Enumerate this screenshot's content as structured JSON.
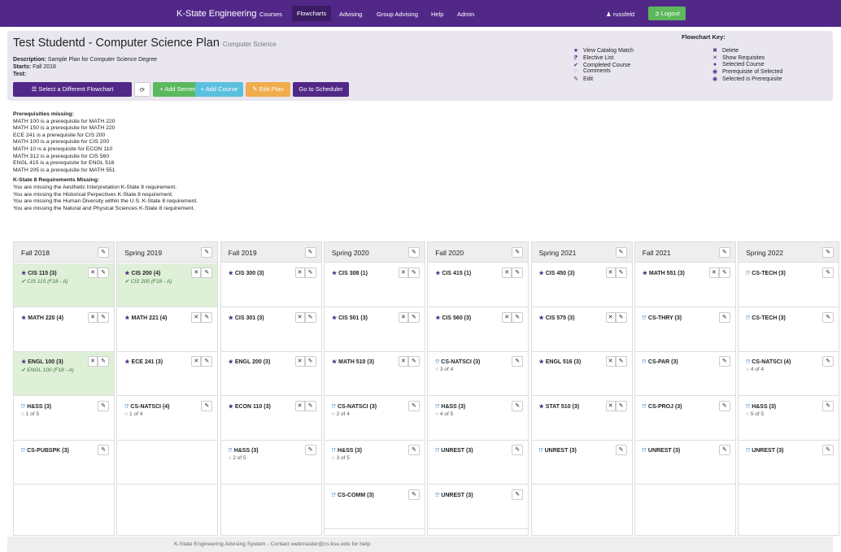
{
  "nav": {
    "brand": "K-State Engineering",
    "links": [
      "Courses",
      "Flowcharts",
      "Advising",
      "Group Advising",
      "Help",
      "Admin"
    ],
    "user": "russfeld",
    "logout": "Logout",
    "user_icon": "user-icon",
    "logout_icon": "sign-out-icon"
  },
  "plan": {
    "title": "Test Studentd - Computer Science Plan",
    "program": "Computer Science",
    "description_label": "Description:",
    "description": "Sample Plan for Computer Science Degree",
    "starts_label": "Starts:",
    "starts": "Fall 2018",
    "test_label": "Test:"
  },
  "buttons": {
    "select": "Select a Different Flowchart",
    "refresh": "⟳",
    "add_semester": "+ Add Semester",
    "add_course": "+ Add Course",
    "edit_plan": "Edit Plan",
    "scheduler": "Go to Scheduler"
  },
  "key": {
    "title": "Flowchart Key:",
    "left": [
      {
        "sym": "★",
        "label": "View Catalog Match"
      },
      {
        "sym": "⁋",
        "label": "Elective List"
      },
      {
        "sym": "✔",
        "label": "Completed Course"
      },
      {
        "sym": "◌",
        "label": "Comments"
      },
      {
        "sym": "✎",
        "label": "Edit"
      }
    ],
    "right": [
      {
        "sym": "✖",
        "label": "Delete"
      },
      {
        "sym": "✕",
        "label": "Show Requisites"
      },
      {
        "sym": "●",
        "label": "Selected Course"
      },
      {
        "sym": "◉",
        "label": "Prerequisite of Selected"
      },
      {
        "sym": "◉",
        "label": "Selected is Prerequisite"
      }
    ]
  },
  "prereqs": {
    "heading": "Prerequisities missing:",
    "items": [
      "MATH 100 is a prerequisite for MATH 220",
      "MATH 150 is a prerequisite for MATH 220",
      "ECE 241 is a prerequisite for CIS 200",
      "MATH 100 is a prerequisite for CIS 200",
      "MATH 10 is a prerequisite for ECON 110",
      "MATH 312 is a prerequisite for CIS 560",
      "ENGL 415 is a prerequisite for ENGL 516",
      "MATH 205 is a prerequisite for MATH 551"
    ]
  },
  "kstate8": {
    "heading": "K-State 8 Requirements Missing:",
    "items": [
      "You are missing the Aesthetic Interpretation K-State 8 requirement.",
      "You are missing the Historical Perpectives K-State 8 requirement.",
      "You are missing the Human Diversity within the U.S. K-State 8 requirement.",
      "You are missing the Natural and Physical Sciences K-State 8 requirement."
    ]
  },
  "semesters": [
    {
      "name": "Fall 2018",
      "courses": [
        {
          "icon": "star",
          "name": "CIS 115 (3)",
          "sub": "CIS 115 (F18 - A)",
          "done": true,
          "req": true
        },
        {
          "icon": "star",
          "name": "MATH 220 (4)",
          "sub": "",
          "done": false,
          "req": true
        },
        {
          "icon": "star",
          "name": "ENGL 100 (3)",
          "sub": "ENGL 100 (F18 - A)",
          "done": true,
          "req": true
        },
        {
          "icon": "flag",
          "name": "H&SS (3)",
          "sub": "1 of 5",
          "done": false,
          "req": false
        },
        {
          "icon": "flag",
          "name": "CS-PUBSPK (3)",
          "sub": "",
          "done": false,
          "req": false
        }
      ]
    },
    {
      "name": "Spring 2019",
      "courses": [
        {
          "icon": "star",
          "name": "CIS 200 (4)",
          "sub": "CIS 200 (F18 - A)",
          "done": true,
          "req": true
        },
        {
          "icon": "star",
          "name": "MATH 221 (4)",
          "sub": "",
          "done": false,
          "req": true
        },
        {
          "icon": "star",
          "name": "ECE 241 (3)",
          "sub": "",
          "done": false,
          "req": true
        },
        {
          "icon": "flag",
          "name": "CS-NATSCI (4)",
          "sub": "1 of 4",
          "done": false,
          "req": false
        }
      ]
    },
    {
      "name": "Fall 2019",
      "courses": [
        {
          "icon": "star",
          "name": "CIS 300 (3)",
          "sub": "",
          "done": false,
          "req": true
        },
        {
          "icon": "star",
          "name": "CIS 301 (3)",
          "sub": "",
          "done": false,
          "req": true
        },
        {
          "icon": "star",
          "name": "ENGL 200 (3)",
          "sub": "",
          "done": false,
          "req": true
        },
        {
          "icon": "star",
          "name": "ECON 110 (3)",
          "sub": "",
          "done": false,
          "req": true
        },
        {
          "icon": "flag",
          "name": "H&SS (3)",
          "sub": "2 of 5",
          "done": false,
          "req": false
        }
      ]
    },
    {
      "name": "Spring 2020",
      "courses": [
        {
          "icon": "star",
          "name": "CIS 308 (1)",
          "sub": "",
          "done": false,
          "req": true
        },
        {
          "icon": "star",
          "name": "CIS 501 (3)",
          "sub": "",
          "done": false,
          "req": true
        },
        {
          "icon": "star",
          "name": "MATH 510 (3)",
          "sub": "",
          "done": false,
          "req": true
        },
        {
          "icon": "flag",
          "name": "CS-NATSCI (3)",
          "sub": "2 of 4",
          "done": false,
          "req": false
        },
        {
          "icon": "flag",
          "name": "H&SS (3)",
          "sub": "3 of 5",
          "done": false,
          "req": false
        },
        {
          "icon": "flag",
          "name": "CS-COMM (3)",
          "sub": "",
          "done": false,
          "req": false
        }
      ]
    },
    {
      "name": "Fall 2020",
      "courses": [
        {
          "icon": "star",
          "name": "CIS 415 (1)",
          "sub": "",
          "done": false,
          "req": true
        },
        {
          "icon": "star",
          "name": "CIS 560 (3)",
          "sub": "",
          "done": false,
          "req": true
        },
        {
          "icon": "flag",
          "name": "CS-NATSCI (3)",
          "sub": "3 of 4",
          "done": false,
          "req": false
        },
        {
          "icon": "flag",
          "name": "H&SS (3)",
          "sub": "4 of 5",
          "done": false,
          "req": false
        },
        {
          "icon": "flag",
          "name": "UNREST (3)",
          "sub": "",
          "done": false,
          "req": false
        },
        {
          "icon": "flag",
          "name": "UNREST (3)",
          "sub": "",
          "done": false,
          "req": false
        }
      ]
    },
    {
      "name": "Spring 2021",
      "courses": [
        {
          "icon": "star",
          "name": "CIS 450 (3)",
          "sub": "",
          "done": false,
          "req": true
        },
        {
          "icon": "star",
          "name": "CIS 575 (3)",
          "sub": "",
          "done": false,
          "req": true
        },
        {
          "icon": "star",
          "name": "ENGL 516 (3)",
          "sub": "",
          "done": false,
          "req": true
        },
        {
          "icon": "star",
          "name": "STAT 510 (3)",
          "sub": "",
          "done": false,
          "req": true
        },
        {
          "icon": "flag",
          "name": "UNREST (3)",
          "sub": "",
          "done": false,
          "req": false
        }
      ]
    },
    {
      "name": "Fall 2021",
      "courses": [
        {
          "icon": "star",
          "name": "MATH 551 (3)",
          "sub": "",
          "done": false,
          "req": true
        },
        {
          "icon": "flag",
          "name": "CS-THRY (3)",
          "sub": "",
          "done": false,
          "req": false
        },
        {
          "icon": "flag",
          "name": "CS-PAR (3)",
          "sub": "",
          "done": false,
          "req": false
        },
        {
          "icon": "flag",
          "name": "CS-PROJ (3)",
          "sub": "",
          "done": false,
          "req": false
        },
        {
          "icon": "flag",
          "name": "UNREST (3)",
          "sub": "",
          "done": false,
          "req": false
        }
      ]
    },
    {
      "name": "Spring 2022",
      "courses": [
        {
          "icon": "flag",
          "name": "CS-TECH (3)",
          "sub": "",
          "done": false,
          "req": false
        },
        {
          "icon": "flag",
          "name": "CS-TECH (3)",
          "sub": "",
          "done": false,
          "req": false
        },
        {
          "icon": "flag",
          "name": "CS-NATSCI (4)",
          "sub": "4 of 4",
          "done": false,
          "req": false
        },
        {
          "icon": "flag",
          "name": "H&SS (3)",
          "sub": "5 of 5",
          "done": false,
          "req": false
        },
        {
          "icon": "flag",
          "name": "UNREST (3)",
          "sub": "",
          "done": false,
          "req": false
        }
      ]
    }
  ],
  "footer": "K-State Engineering Advising System - Contact webmaster@cs.ksu.edu for help",
  "colors": {
    "brand": "#512888",
    "success": "#5cb85c",
    "info": "#5bc0de",
    "warning": "#f0ad4e",
    "completed_bg": "#dff0d8"
  }
}
